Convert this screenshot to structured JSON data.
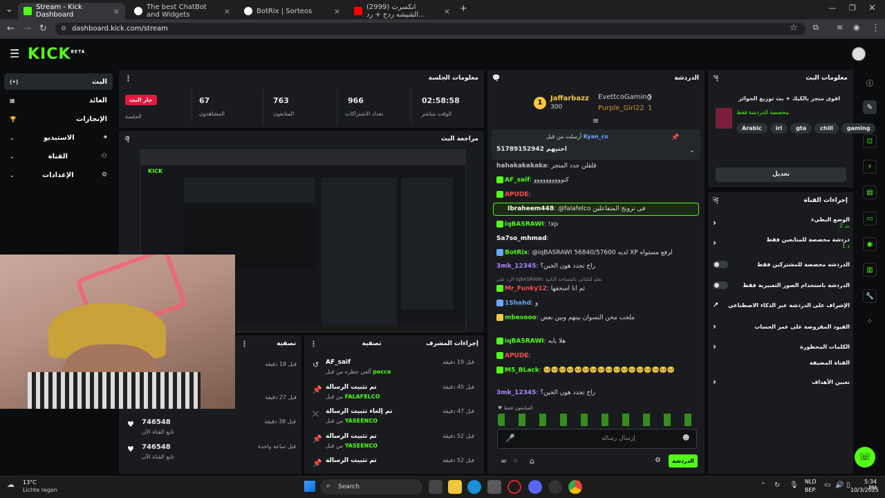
{
  "browser": {
    "tabs": [
      {
        "title": "Stream - Kick Dashboard",
        "color": "#53fc18"
      },
      {
        "title": "The best ChatBot and Widgets",
        "color": "#ffffff"
      },
      {
        "title": "BotRix | Sorteos",
        "color": "#ffffff"
      },
      {
        "title": "(2999) انكسرت الشيشه ردح + رد...",
        "color": "#ff0000"
      }
    ],
    "url": "dashboard.kick.com/stream"
  },
  "kick": {
    "logo": "KICK",
    "beta": "BETA"
  },
  "nav": {
    "items": [
      {
        "label": "البث",
        "icon": "(•)"
      },
      {
        "label": "العائد",
        "icon": "▦"
      },
      {
        "label": "الإنجازات",
        "icon": "🏆"
      },
      {
        "label": "الاستيديو",
        "icon": "⌖"
      },
      {
        "label": "القناة",
        "icon": "⚇"
      },
      {
        "label": "الإعدادات",
        "icon": "⚙"
      }
    ]
  },
  "session": {
    "title": "معلومات الجلسة",
    "live_badge": "جار البث",
    "stats": [
      {
        "value": "",
        "label": "الجلسة"
      },
      {
        "value": "67",
        "label": "المشاهدون"
      },
      {
        "value": "763",
        "label": "المتابعون"
      },
      {
        "value": "966",
        "label": "تعداد الاشتراكات"
      },
      {
        "value": "02:58:58",
        "label": "الوقت مباشر"
      }
    ]
  },
  "preview": {
    "title": "مراجعة البث"
  },
  "followers_panel": {
    "title": "تصفية",
    "rows": [
      {
        "name": "",
        "sub": "",
        "time": "قبل 18 دقيقة"
      },
      {
        "name": "",
        "sub": "",
        "time": "قبل 27 دقيقة"
      },
      {
        "name": "746548",
        "sub": "تابع القناة الآن",
        "time": "قبل 38 دقيقة"
      },
      {
        "name": "746548",
        "sub": "تابع القناة الآن",
        "time": "قبل ساعة واحدة"
      }
    ]
  },
  "mod_actions": {
    "title": "إجراءات المشرف",
    "filter": "تصفية",
    "rows": [
      {
        "title": "AF_saif",
        "sub_prefix": "ألغي حظره من قبل",
        "by": "pocca",
        "time": "قبل 19 دقيقة",
        "icon": "↺"
      },
      {
        "title": "تم تثبيت الرسالة",
        "sub_prefix": "من قبل",
        "by": "FALAFELCO",
        "time": "قبل 45 دقيقة",
        "icon": "📌"
      },
      {
        "title": "تم إلغاء تثبيت الرسالة",
        "sub_prefix": "من قبل",
        "by": "YASEENCO",
        "time": "قبل 47 دقيقة",
        "icon": "⤫"
      },
      {
        "title": "تم تثبيت الرسالة",
        "sub_prefix": "من قبل",
        "by": "YASEENCO",
        "time": "قبل 52 دقيقة",
        "icon": "📌"
      },
      {
        "title": "تم تثبيت الرسالة",
        "sub_prefix": "من قبل",
        "by": "",
        "time": "قبل 52 دقيقة",
        "icon": "📌"
      }
    ]
  },
  "chat": {
    "title": "الدردشة",
    "leaderboard": [
      {
        "name": "Jaffarbazz",
        "count": "300",
        "color": "#f6c744"
      },
      {
        "name": "EvettcoGaming",
        "count": "5",
        "color": "#cfcfcf"
      },
      {
        "name": "Purple_Girl22",
        "count": "1",
        "color": "#d98b3a"
      }
    ],
    "pinned": {
      "from": "Kyan_co",
      "label": "أرسلت من قبل",
      "text": "51789152942 احتيهم"
    },
    "messages": [
      {
        "user": "hahakakakaka",
        "color": "#bdbdbd",
        "text": "فلقلن جدد المتجر"
      },
      {
        "user": "AF_saif",
        "color": "#53fc18",
        "text": "كنوووووووووو"
      },
      {
        "user": "APUDE",
        "color": "#ff4d4d",
        "text": ""
      },
      {
        "user": "Ibraheem448",
        "color": "#ffffff",
        "text": "@falafelco في ترويج المتفاعلين"
      },
      {
        "user": "iqBASRAWI",
        "color": "#53fc18",
        "text": "!xp"
      },
      {
        "user": "Sa7so_mhmad",
        "color": "#ffffff",
        "text": ""
      },
      {
        "user": "BotRix",
        "color": "#53fc18",
        "text": "@iqBASRAWI 56840/57600 لديه XP لرفع مستواه"
      },
      {
        "user": "3mk_12345",
        "color": "#b086ff",
        "text": "راح تجدد هون الخبن؟"
      },
      {
        "user": "Mr_Funky12",
        "color": "#ff4d4d",
        "text": "ثم انا اسحقها"
      },
      {
        "user": "1Shahd",
        "color": "#6aa9ff",
        "text": "و"
      },
      {
        "user": "mbesooo",
        "color": "#53fc18",
        "text": "ملحب محن النسوان بينهم وبين بعض"
      },
      {
        "user": "iqBASRAWI",
        "color": "#53fc18",
        "text": "هلا بابه"
      },
      {
        "user": "APUDE",
        "color": "#ff4d4d",
        "text": ""
      },
      {
        "user": "M5_BLack",
        "color": "#53fc18",
        "text": "🥺🥺🥺🥺🥺🥺🥺🥺🥺🥺🥺🥺🥺🥺🥺🥺🥺"
      },
      {
        "user": "3mk_12345",
        "color": "#b086ff",
        "text": "راح تجدد هون الخبن؟"
      }
    ],
    "reply_to": "الرد على iqBASRAWI: تعلم للكتابي بالمساحة الثانية",
    "followers_only": "المتابعون فقط",
    "input_placeholder": "إرسال رسالة",
    "send_button": "الدردشة"
  },
  "stream_info": {
    "title": "معلومات البث",
    "stream_title": "اقوى متجر بالكيك + بث توزيع الجوائز",
    "category": "مخصصة للدردشة فقط",
    "tags": [
      "Arabic",
      "irl",
      "gta",
      "chill",
      "gaming"
    ],
    "edit_button": "تعديل"
  },
  "channel_actions": {
    "title": "إجراءات القناة",
    "rows": [
      {
        "label": "الوضع البطيء",
        "sub": "2 ث",
        "control": "›"
      },
      {
        "label": "دردشة مخصصة للمتابعين فقط",
        "sub": "1 د",
        "control": "›"
      },
      {
        "label": "الدردشة مخصصة للمشتركين فقط",
        "sub": "",
        "control": "toggle"
      },
      {
        "label": "الدردشة باستخدام الصور التعبيرية فقط",
        "sub": "",
        "control": "toggle"
      },
      {
        "label": "الإشراف على الدردشة عبر الذكاء الاصطناعي",
        "sub": "",
        "control": "↗"
      },
      {
        "label": "القيود المفروضة على عمر الحساب",
        "sub": "",
        "control": "›"
      },
      {
        "label": "الكلمات المحظورة",
        "sub": "",
        "control": "›"
      },
      {
        "label": "القناة المضيفة",
        "sub": "",
        "control": ""
      },
      {
        "label": "تعيين الأهداف",
        "sub": "",
        "control": "›"
      }
    ]
  },
  "taskbar": {
    "weather_temp": "13°C",
    "weather_desc": "Lichte regen",
    "search": "Search",
    "lang": "NLD",
    "lang2": "BEP",
    "time": "5:34 PM",
    "date": "10/3/2025"
  },
  "colors": {
    "accent": "#53fc18",
    "panel": "#191b1f",
    "bg": "#0b0c0d"
  }
}
